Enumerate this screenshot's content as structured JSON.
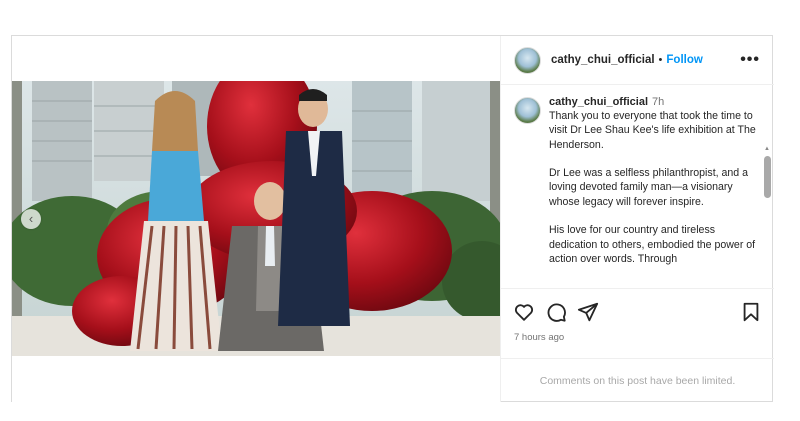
{
  "post": {
    "username": "cathy_chui_official",
    "separator": "•",
    "follow_label": "Follow",
    "more_icon": "more-horizontal-icon",
    "more_label": "•••",
    "caption": {
      "username": "cathy_chui_official",
      "time": "7h",
      "text": "Thank you to everyone that took the time to visit Dr Lee Shau Kee's life exhibition at The Henderson.\n\nDr Lee was a selfless philanthropist, and a loving devoted family man—a visionary whose legacy will forever inspire.\n\nHis love for our country and tireless dedication to others, embodied the power of action over words. Through"
    },
    "actions": {
      "like_icon": "heart-icon",
      "comment_icon": "comment-icon",
      "share_icon": "send-icon",
      "save_icon": "bookmark-icon"
    },
    "timestamp": "7 hours ago",
    "comments_notice": "Comments on this post have been limited.",
    "carousel_prev_label": "‹"
  },
  "colors": {
    "accent": "#0095f6",
    "sculpture_red": "#b3121f",
    "border": "#dbdbdb"
  }
}
